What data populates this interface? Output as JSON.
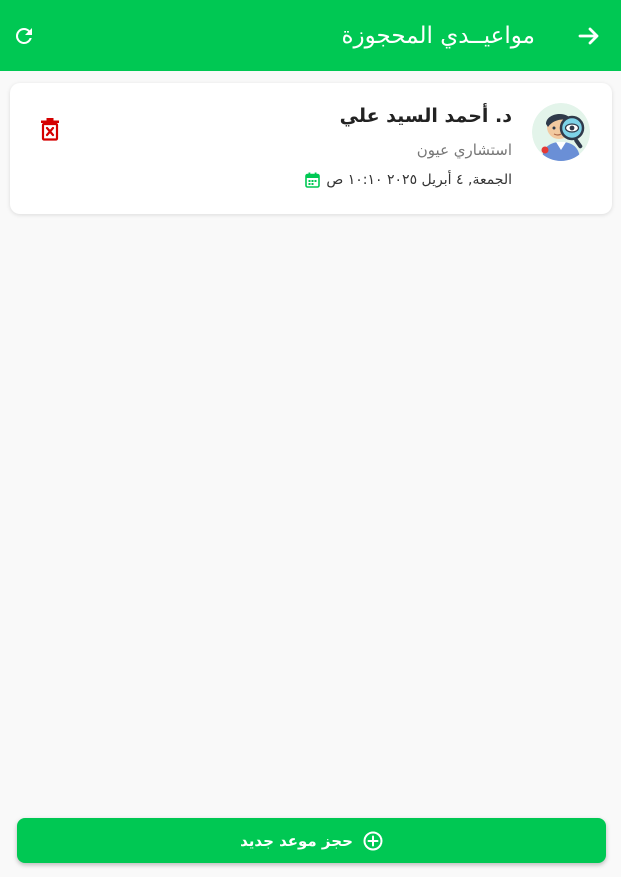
{
  "header": {
    "title": "مواعيــدي المحجوزة",
    "back_icon": "arrow-right-icon",
    "refresh_icon": "refresh-icon",
    "background_color": "#00c853"
  },
  "appointments": [
    {
      "doctor_name": "د. أحمد السيد علي",
      "specialty": "استشاري عيون",
      "datetime": "الجمعة, ٤ أبريل ٢٠٢٥ ١٠:١٠ ص",
      "avatar_icon": "eye-doctor-avatar-icon",
      "calendar_icon": "calendar-icon",
      "delete_icon": "trash-icon",
      "delete_color": "#d50000"
    }
  ],
  "footer": {
    "book_label": "حجز موعد جديد",
    "book_icon": "plus-circle-icon",
    "background_color": "#00c853"
  }
}
